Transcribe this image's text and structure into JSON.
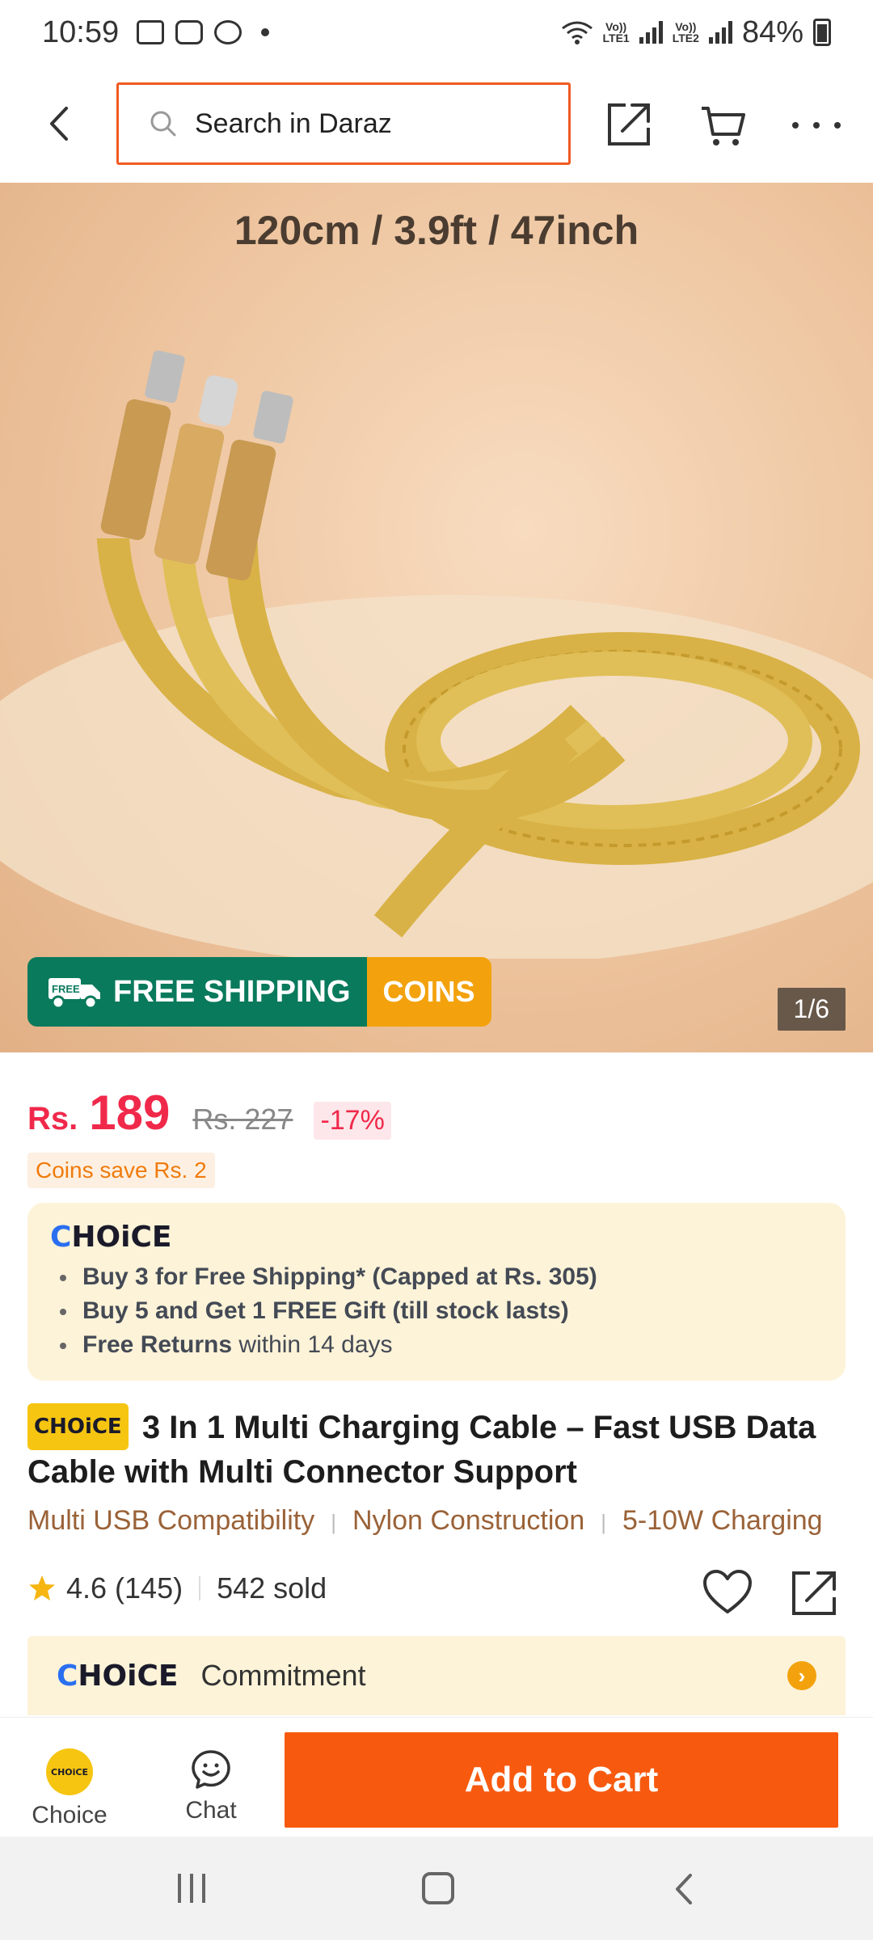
{
  "status_bar": {
    "time": "10:59",
    "lte1": "LTE1",
    "lte2": "LTE2",
    "vo1": "Vo))",
    "vo2": "Vo))",
    "battery": "84%"
  },
  "header": {
    "search_placeholder": "Search in Daraz"
  },
  "product_image": {
    "caption": "120cm / 3.9ft / 47inch",
    "free_badge": "FREE",
    "free_shipping": "FREE SHIPPING",
    "coins": "COINS",
    "counter": "1/6"
  },
  "price": {
    "currency": "Rs.",
    "current": "189",
    "original": "Rs. 227",
    "discount": "-17%",
    "coins_save": "Coins save Rs. 2"
  },
  "choice_box": {
    "logo_c": "C",
    "logo_rest": "HOiCE",
    "perks": [
      {
        "bold": "Buy 3 for  Free Shipping* (Capped at Rs. 305)",
        "regular": ""
      },
      {
        "bold": "Buy 5 and Get 1 FREE Gift (till stock lasts)",
        "regular": ""
      },
      {
        "bold": "Free Returns",
        "regular": " within 14 days"
      }
    ]
  },
  "product": {
    "choice_tag": "CHOiCE",
    "title": "3 In 1 Multi Charging Cable – Fast USB Data Cable with Multi Connector Support",
    "features": [
      "Multi USB Compatibility",
      "Nylon Construction",
      "5-10W Charging"
    ],
    "rating": "4.6",
    "reviews": "(145)",
    "sold": "542 sold"
  },
  "commitment": {
    "logo_c": "C",
    "logo_rest": "HOiCE",
    "label": "Commitment"
  },
  "action_bar": {
    "choice_badge": "CHOiCE",
    "choice_label": "Choice",
    "chat_label": "Chat",
    "add_to_cart": "Add to Cart"
  },
  "colors": {
    "accent": "#f75a0f",
    "price": "#f0294b",
    "choice_yellow": "#f6c511",
    "free_ship_green": "#0a7a5c"
  }
}
